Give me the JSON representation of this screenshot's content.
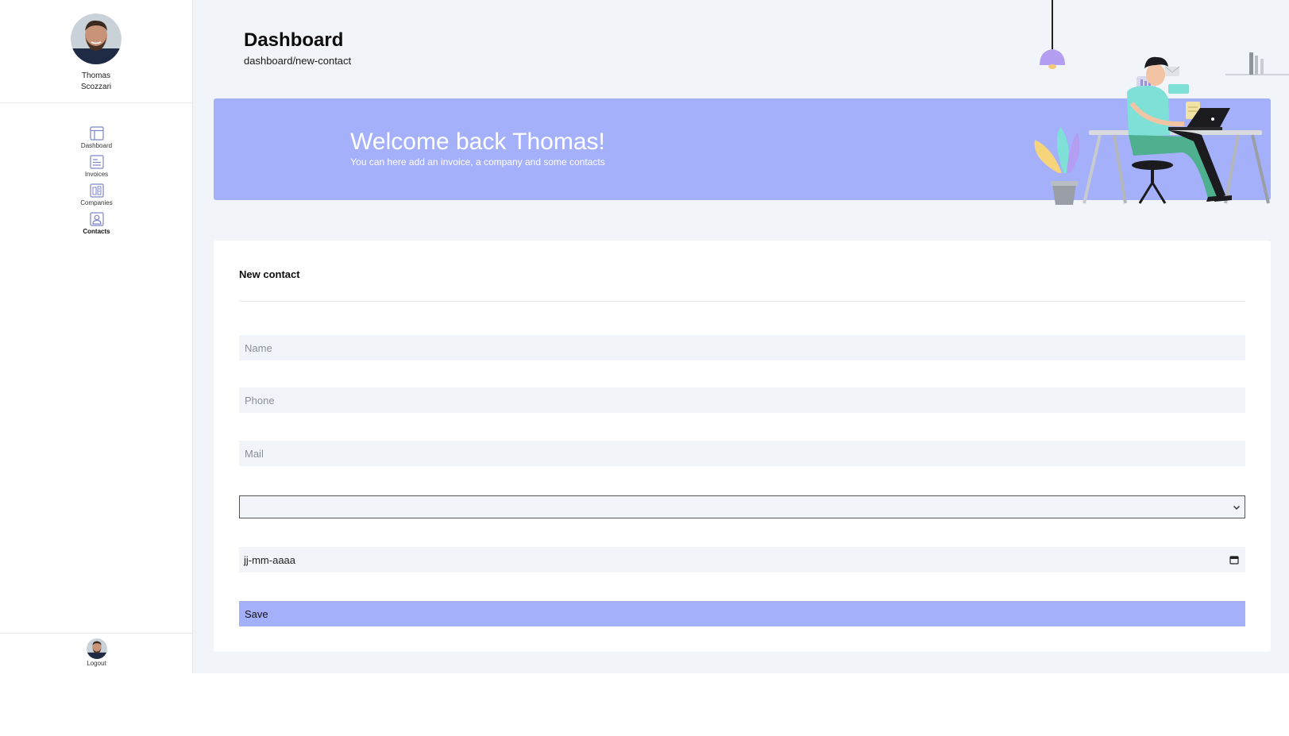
{
  "user": {
    "first_name": "Thomas",
    "last_name": "Scozzari"
  },
  "sidebar": {
    "items": [
      {
        "label": "Dashboard",
        "icon": "layout-icon",
        "active": false
      },
      {
        "label": "Invoices",
        "icon": "list-icon",
        "active": false
      },
      {
        "label": "Companies",
        "icon": "building-icon",
        "active": false
      },
      {
        "label": "Contacts",
        "icon": "user-icon",
        "active": true
      }
    ],
    "logout_label": "Logout"
  },
  "header": {
    "title": "Dashboard",
    "breadcrumb": "dashboard/new-contact"
  },
  "banner": {
    "title": "Welcome back Thomas!",
    "subtitle": "You can here add an invoice, a company and some contacts"
  },
  "form": {
    "title": "New contact",
    "name_placeholder": "Name",
    "phone_placeholder": "Phone",
    "mail_placeholder": "Mail",
    "select_value": "",
    "date_placeholder": "jj-mm-aaaa",
    "save_label": "Save"
  },
  "colors": {
    "accent": "#a5b0fb",
    "background": "#f1f4f8",
    "icon": "#7d86c9"
  }
}
